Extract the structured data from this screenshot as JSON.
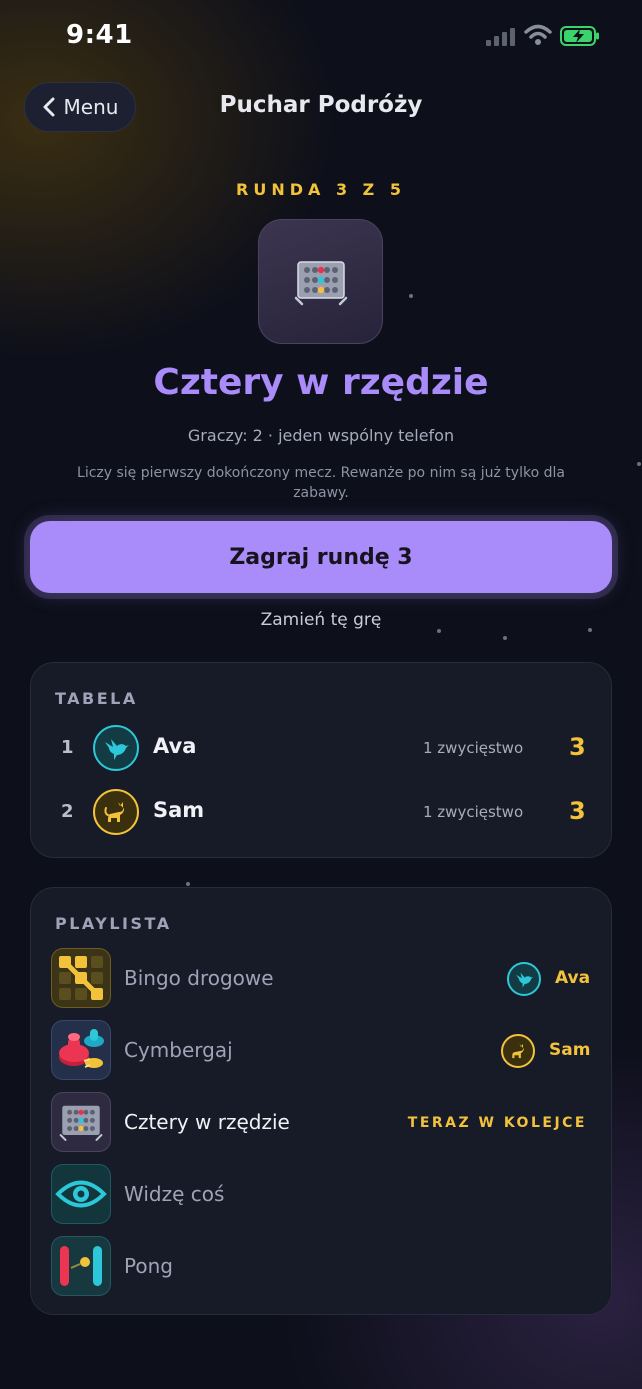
{
  "status_bar": {
    "time": "9:41"
  },
  "nav": {
    "back_label": "Menu",
    "title": "Puchar Podróży"
  },
  "round": {
    "label": "RUNDA 3 Z 5"
  },
  "game": {
    "title": "Cztery w rzędzie",
    "players_info": "Graczy: 2 · jeden wspólny telefon",
    "note": "Liczy się pierwszy dokończony mecz. Rewanże po nim są już tylko dla zabawy."
  },
  "actions": {
    "play_label": "Zagraj rundę 3",
    "swap_label": "Zamień tę grę"
  },
  "leaderboard": {
    "heading": "TABELA",
    "rows": [
      {
        "rank": "1",
        "name": "Ava",
        "wins": "1 zwycięstwo",
        "score": "3",
        "icon": "hummingbird-icon"
      },
      {
        "rank": "2",
        "name": "Sam",
        "wins": "1 zwycięstwo",
        "score": "3",
        "icon": "cat-icon"
      }
    ]
  },
  "playlist": {
    "heading": "PLAYLISTA",
    "items": [
      {
        "name": "Bingo drogowe",
        "winner": "Ava",
        "icon": "bingo-grid-icon"
      },
      {
        "name": "Cymbergaj",
        "winner": "Sam",
        "icon": "air-hockey-icon"
      },
      {
        "name": "Cztery w rzędzie",
        "status": "TERAZ W KOLEJCE",
        "icon": "connect-four-icon"
      },
      {
        "name": "Widzę coś",
        "icon": "eye-icon"
      },
      {
        "name": "Pong",
        "icon": "pong-icon"
      }
    ]
  },
  "colors": {
    "accent": "#a98bfa",
    "gold": "#f2c33a",
    "teal": "#2cc7d8",
    "background": "#0d0f1a"
  }
}
